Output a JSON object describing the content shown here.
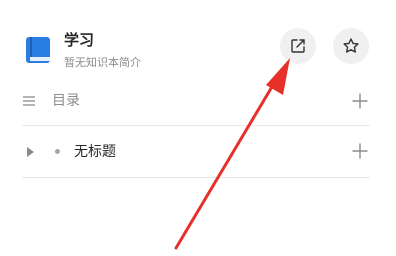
{
  "book": {
    "title": "学习",
    "subtitle": "暂无知识本简介",
    "icon": "book-icon",
    "icon_color": "#2a7de1"
  },
  "header_actions": [
    {
      "icon": "share-icon"
    },
    {
      "icon": "star-icon"
    }
  ],
  "toc": {
    "label": "目录",
    "menu_icon": "list-icon",
    "add_icon": "plus-icon"
  },
  "items": [
    {
      "label": "无标题",
      "expand_icon": "caret-right-icon",
      "add_icon": "plus-icon"
    }
  ],
  "annotation": {
    "arrow_color": "#e8302a",
    "arrow_target": "share-button"
  }
}
